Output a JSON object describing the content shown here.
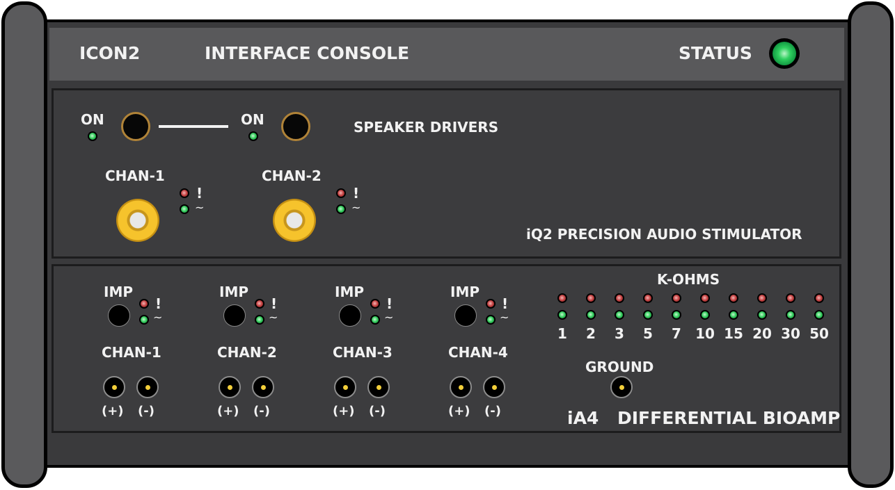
{
  "header": {
    "brand": "ICON2",
    "title": "INTERFACE CONSOLE",
    "status_label": "STATUS",
    "status_color": "#2fcf5f"
  },
  "audio": {
    "speaker_label": "SPEAKER DRIVERS",
    "on_left": "ON",
    "on_right": "ON",
    "chan1": "CHAN-1",
    "chan2": "CHAN-2",
    "warn_symbol": "!",
    "signal_symbol": "~",
    "product": "iQ2 PRECISION AUDIO STIMULATOR"
  },
  "bioamp": {
    "imp_label": "IMP",
    "warn_symbol": "!",
    "signal_symbol": "~",
    "channels": [
      "CHAN-1",
      "CHAN-2",
      "CHAN-3",
      "CHAN-4"
    ],
    "plus": "(+)",
    "minus": "(-)",
    "kohms_label": "K-OHMS",
    "kohms_values": [
      "1",
      "2",
      "3",
      "5",
      "7",
      "10",
      "15",
      "20",
      "30",
      "50"
    ],
    "ground_label": "GROUND",
    "model": "iA4",
    "product": "DIFFERENTIAL BIOAMP"
  },
  "colors": {
    "led_green": "#31c95a",
    "led_red": "#c24040",
    "rca_gold": "#f6c32c",
    "panel": "#3c3c3e",
    "bar": "#59595b"
  }
}
